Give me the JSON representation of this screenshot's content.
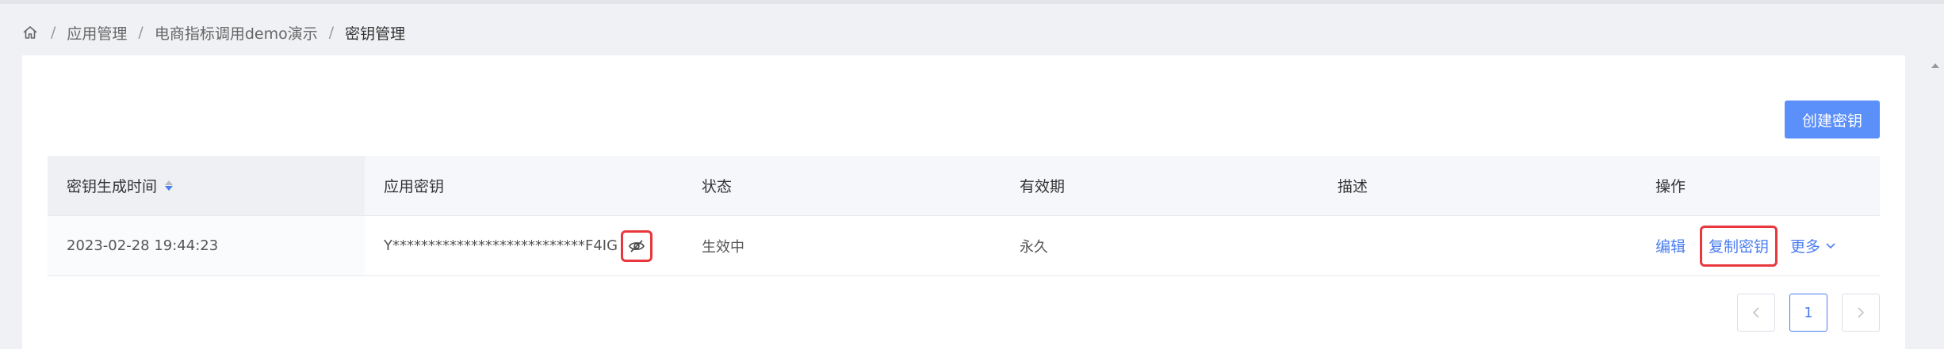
{
  "breadcrumb": {
    "items": [
      "应用管理",
      "电商指标调用demo演示",
      "密钥管理"
    ],
    "separator": "/"
  },
  "toolbar": {
    "create_label": "创建密钥"
  },
  "table": {
    "headers": [
      "密钥生成时间",
      "应用密钥",
      "状态",
      "有效期",
      "描述",
      "操作"
    ],
    "rows": [
      {
        "created_at": "2023-02-28 19:44:23",
        "key": "Y***************************F4IG",
        "status": "生效中",
        "validity": "永久",
        "description": "",
        "actions": {
          "edit": "编辑",
          "copy": "复制密钥",
          "more": "更多"
        }
      }
    ]
  },
  "pagination": {
    "current": "1"
  },
  "colors": {
    "accent": "#5b8ff9",
    "link": "#4a7df0",
    "highlight": "#e8383d"
  }
}
